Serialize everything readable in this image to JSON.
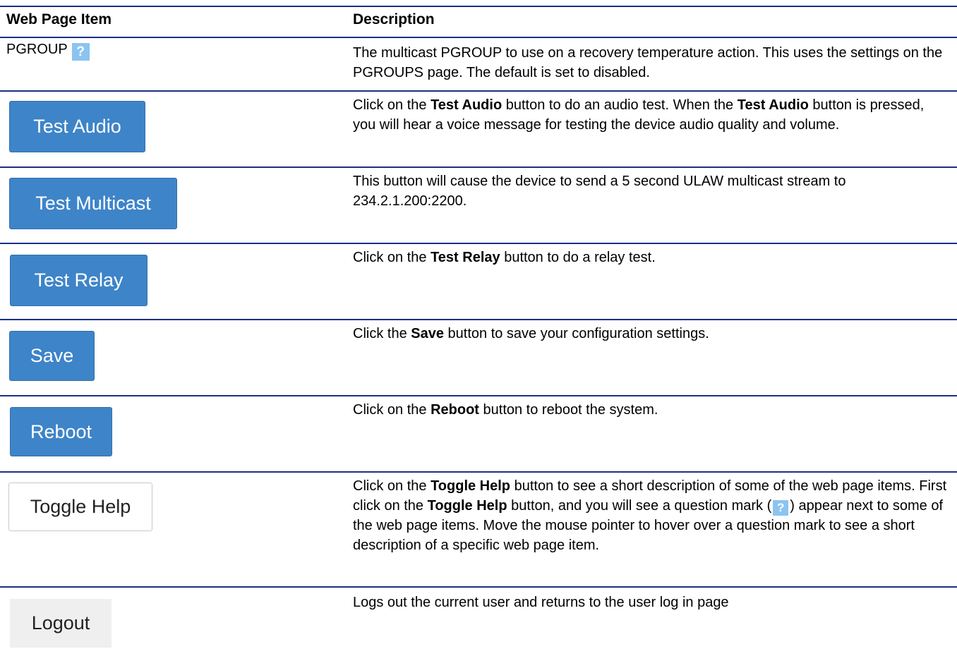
{
  "table": {
    "headers": {
      "item": "Web Page Item",
      "description": "Description"
    },
    "rows": [
      {
        "item_label": "PGROUP",
        "help_icon": "help-question-icon",
        "description": {
          "part1": "The multicast PGROUP to use on a recovery temperature action. This uses the settings on the PGROUPS page. The default is set to disabled."
        }
      },
      {
        "button_label": "Test Audio",
        "description": {
          "part1": "Click on the ",
          "bold1": "Test Audio",
          "part2": " button to do an audio test. When the ",
          "bold2": "Test Audio",
          "part3": " button is pressed, you will hear a voice message for testing the device audio quality and volume."
        }
      },
      {
        "button_label": "Test Multicast",
        "description": {
          "part1": "This button will cause the device to send a 5 second ULAW multicast stream to 234.2.1.200:2200."
        }
      },
      {
        "button_label": "Test Relay",
        "description": {
          "part1": "Click on the ",
          "bold1": "Test Relay",
          "part2": " button to do a relay test."
        }
      },
      {
        "button_label": "Save",
        "description": {
          "part1": "Click the ",
          "bold1": "Save",
          "part2": " button to save your configuration settings."
        }
      },
      {
        "button_label": "Reboot",
        "description": {
          "part1": "Click on the ",
          "bold1": "Reboot",
          "part2": " button to reboot the system."
        }
      },
      {
        "button_label": "Toggle Help",
        "description": {
          "part1": "Click on the ",
          "bold1": "Toggle Help",
          "part2": " button to see a short description of some of the web page items. First click on the ",
          "bold2": "Toggle Help",
          "part3": " button, and you will see a question mark (",
          "part4": ") appear next to some of the web page items. Move the mouse pointer to hover over a question mark to see a short description of a specific web page item."
        }
      },
      {
        "button_label": "Logout",
        "description": {
          "part1": "Logs out the current user and returns to the user log in page"
        }
      }
    ]
  },
  "colors": {
    "rule": "#1e2e84",
    "primary_button": "#3e84c8",
    "help_icon": "#8cc4ef"
  }
}
